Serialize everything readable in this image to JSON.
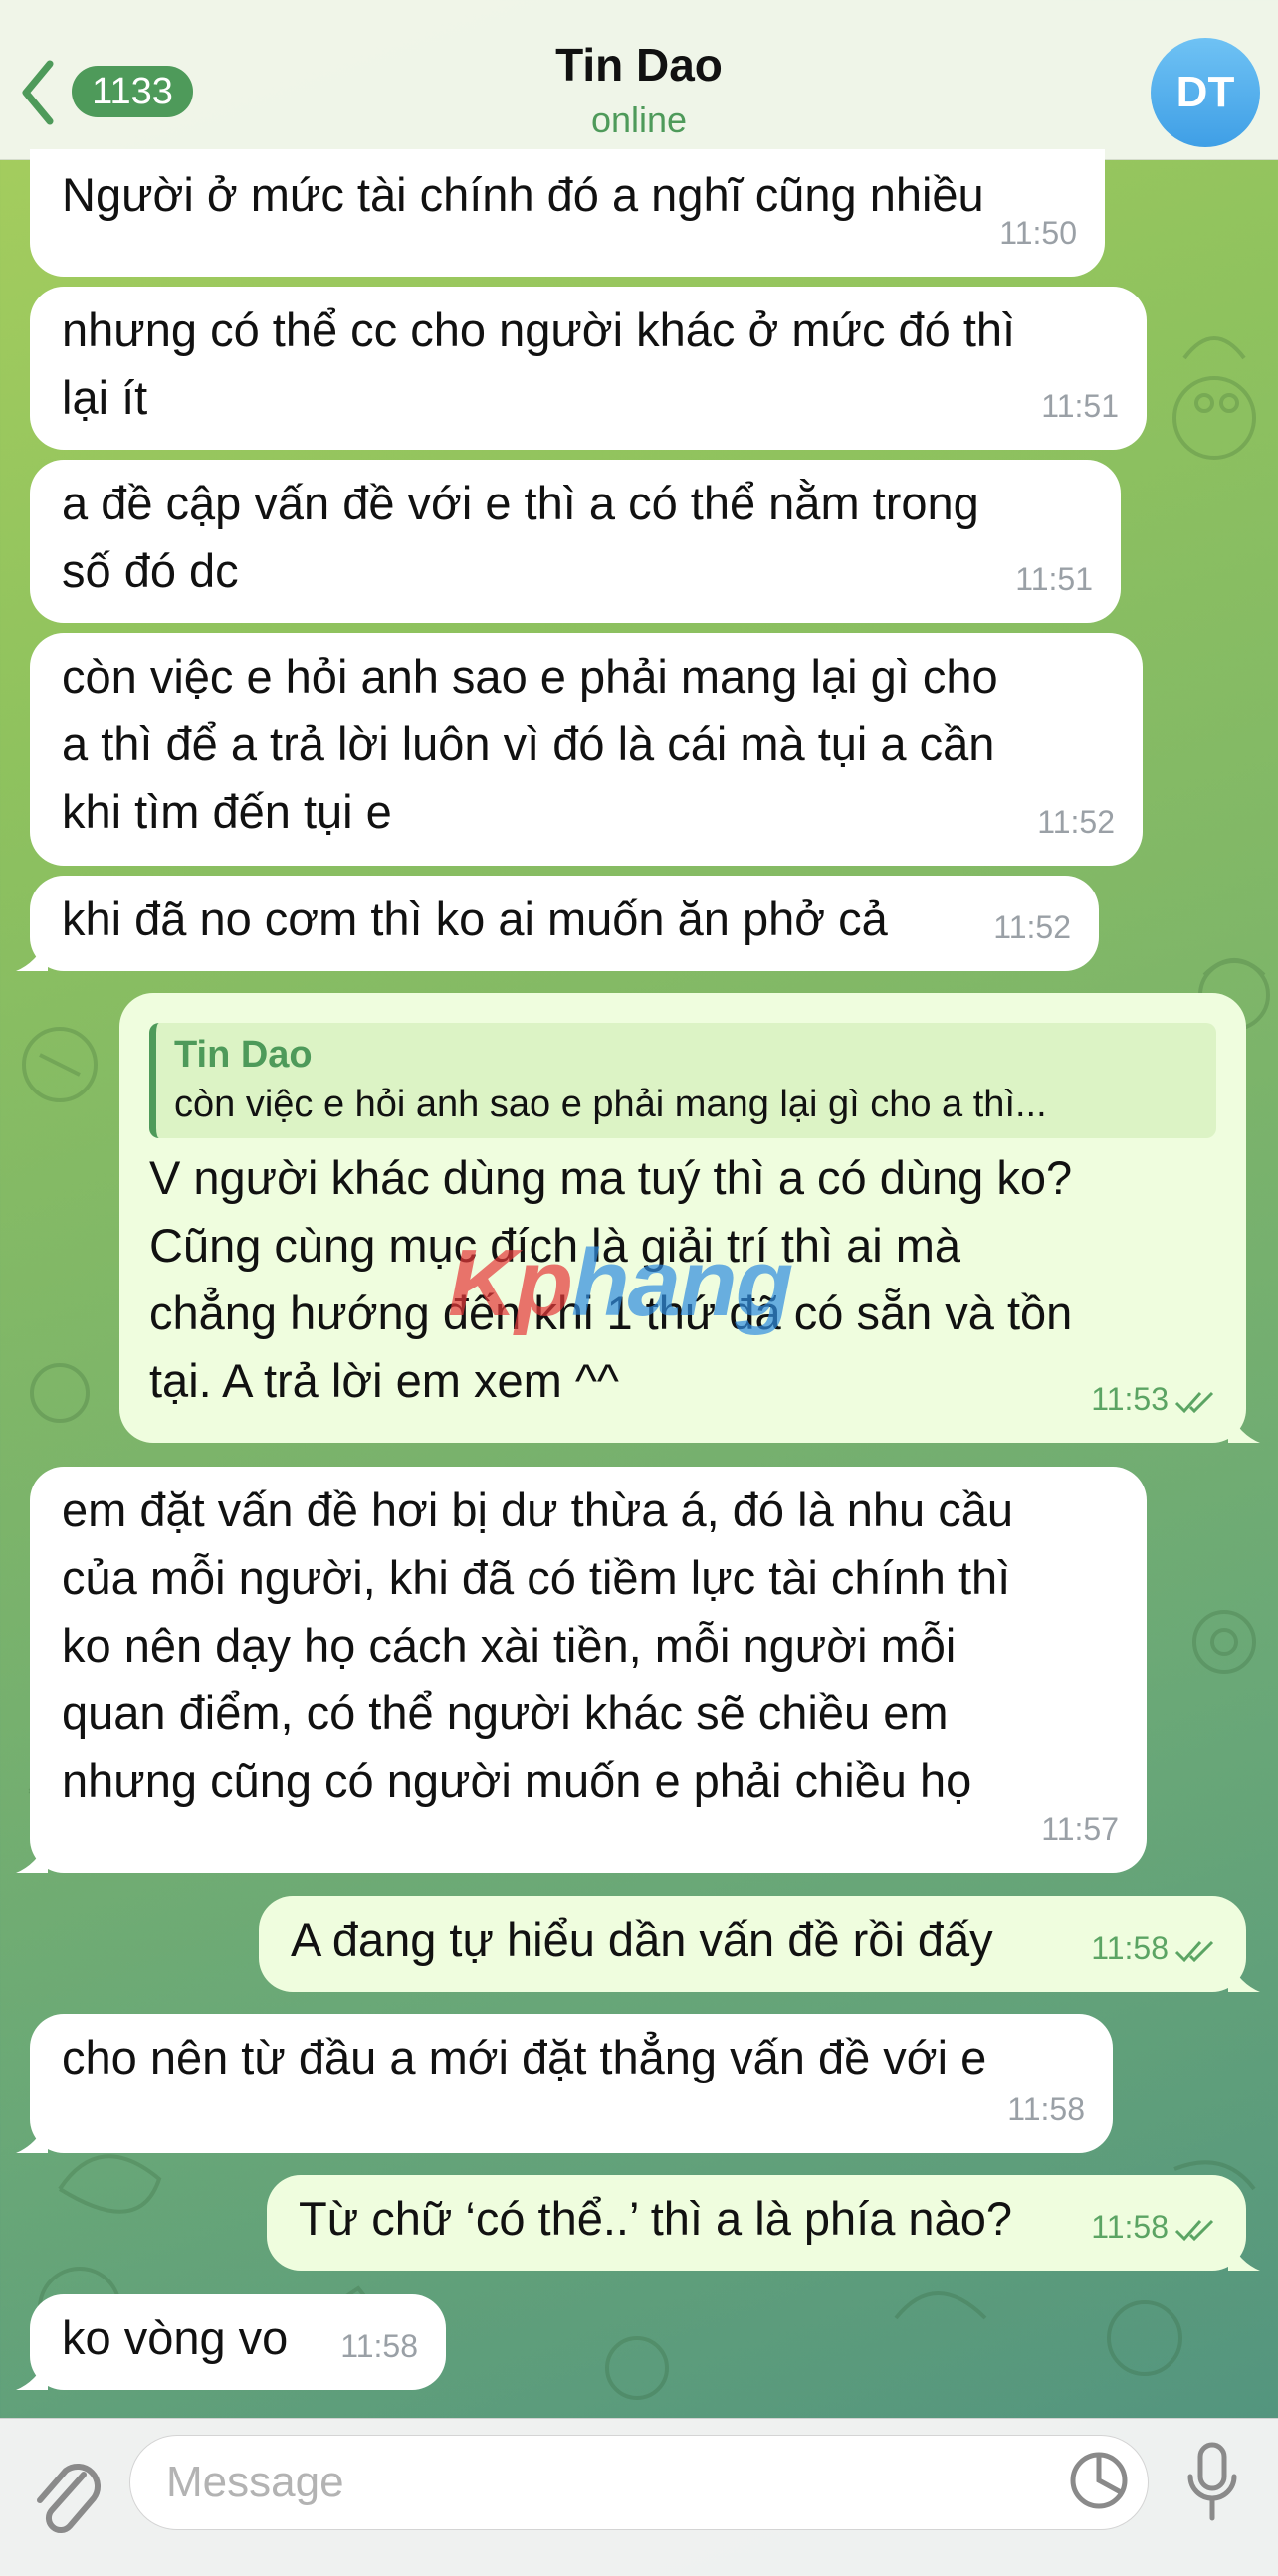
{
  "header": {
    "back_count": "1133",
    "title": "Tin Dao",
    "status": "online",
    "avatar_initials": "DT"
  },
  "messages": [
    {
      "dir": "in",
      "text": "Người ở mức tài chính đó a nghĩ cũng nhiều",
      "time": "11:50"
    },
    {
      "dir": "in",
      "text": "nhưng có thể cc cho người khác ở mức đó thì\nlại ít",
      "time": "11:51"
    },
    {
      "dir": "in",
      "text": "a đề cập vấn đề với e thì a có thể nằm trong\nsố đó dc",
      "time": "11:51"
    },
    {
      "dir": "in",
      "text": "còn việc e hỏi anh sao e phải mang lại gì cho\na thì để a trả lời luôn vì đó là cái mà tụi a cần\nkhi tìm đến tụi e",
      "time": "11:52"
    },
    {
      "dir": "in",
      "text": "khi đã no cơm thì ko ai muốn ăn phở cả",
      "time": "11:52"
    },
    {
      "dir": "out",
      "reply_name": "Tin Dao",
      "reply_text": "còn việc e hỏi anh sao e phải mang lại gì cho a thì...",
      "text": "V người khác dùng ma tuý thì a có dùng ko?\nCũng cùng mục đích là giải trí thì ai mà\nchẳng hướng đến khi 1 thứ đã có sẵn và tồn\ntại. A trả lời em xem ^^",
      "time": "11:53"
    },
    {
      "dir": "in",
      "text": "em đặt vấn đề hơi bị dư thừa á, đó là nhu cầu\ncủa mỗi người, khi đã có tiềm lực tài chính thì\nko nên dạy họ cách xài tiền, mỗi người mỗi\nquan điểm, có thể người khác sẽ chiều em\nnhưng cũng có người muốn e phải chiều họ",
      "time": "11:57"
    },
    {
      "dir": "out",
      "text": "A đang tự hiểu dần vấn đề rồi đấy",
      "time": "11:58"
    },
    {
      "dir": "in",
      "text": "cho nên từ đầu a mới đặt thẳng vấn đề với e",
      "time": "11:58"
    },
    {
      "dir": "out",
      "text": "Từ chữ ‘có thể..’ thì a là phía nào?",
      "time": "11:58"
    },
    {
      "dir": "in",
      "text": "ko vòng vo",
      "time": "11:58"
    }
  ],
  "watermark": {
    "part1": "Kp",
    "part2": "hang"
  },
  "composer": {
    "placeholder": "Message"
  },
  "icons": {
    "back": "chevron-left-icon",
    "attach": "paperclip-icon",
    "sticker": "sticker-icon",
    "mic": "microphone-icon",
    "read": "double-check-icon"
  },
  "colors": {
    "accent": "#4e9a5a",
    "incoming": "#ffffff",
    "outgoing": "#effdde",
    "avatar": "#4aa8ec"
  }
}
